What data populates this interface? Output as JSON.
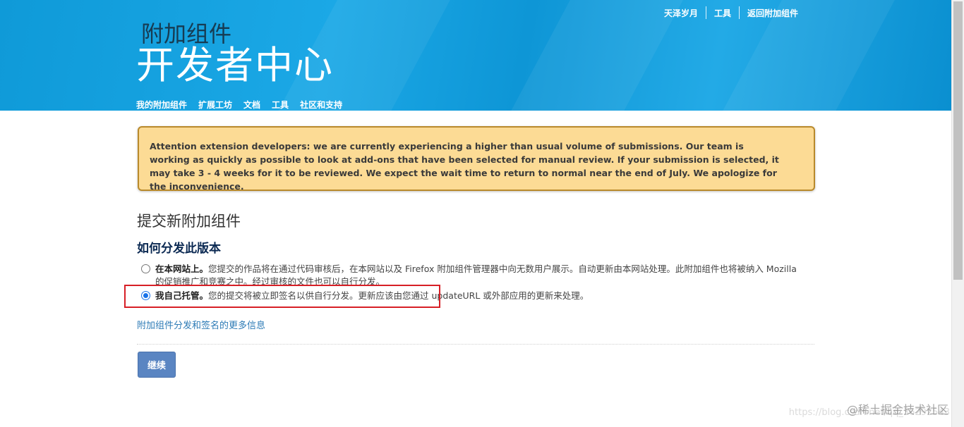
{
  "header": {
    "top_links": [
      "天泽岁月",
      "工具",
      "返回附加组件"
    ],
    "logo_small": "附加组件",
    "logo_big": "开发者中心",
    "nav": [
      "我的附加组件",
      "扩展工坊",
      "文档",
      "工具",
      "社区和支持"
    ]
  },
  "notice": {
    "text": "Attention extension developers: we are currently experiencing a higher than usual volume of submissions. Our team is working as quickly as possible to look at add-ons that have been selected for manual review. If your submission is selected, it may take 3 - 4 weeks for it to be reviewed. We expect the wait time to return to normal near the end of July. We apologize for the inconvenience."
  },
  "main": {
    "page_title": "提交新附加组件",
    "section_title": "如何分发此版本",
    "options": [
      {
        "label": "在本网站上。",
        "description": "您提交的作品将在通过代码审核后，在本网站以及 Firefox 附加组件管理器中向无数用户展示。自动更新由本网站处理。此附加组件也将被纳入 Mozilla 的促销推广和竞赛之中。经过审核的文件也可以自行分发。",
        "selected": false
      },
      {
        "label": "我自己托管。",
        "description": "您的提交将被立即签名以供自行分发。更新应该由您通过 updateURL 或外部应用的更新来处理。",
        "selected": true
      }
    ],
    "more_info_link": "附加组件分发和签名的更多信息",
    "continue_label": "继续"
  },
  "watermark": "@稀土掘金技术社区",
  "watermark_faint": "https://blog.csdn.net/qq_36292543",
  "colors": {
    "header_blue": "#1ba8e6",
    "notice_bg": "#fcdb95",
    "button_blue": "#5a85c2",
    "link_blue": "#2d7bb6",
    "highlight_red": "#d71f26"
  }
}
